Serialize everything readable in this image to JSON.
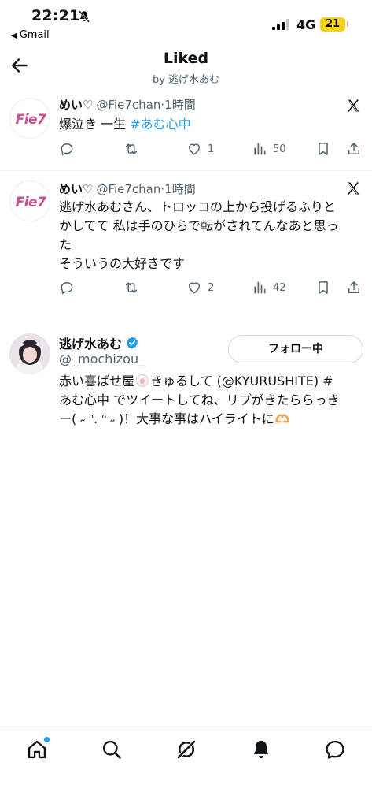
{
  "status_bar": {
    "time": "22:21",
    "back_app": "Gmail",
    "network": "4G",
    "battery": "21"
  },
  "header": {
    "title": "Liked",
    "subtitle": "by 逃げ水あむ"
  },
  "tweets": [
    {
      "name": "めい♡",
      "handle": "@Fie7chan",
      "time": "·1時間",
      "text": "爆泣き 一生 ",
      "hashtag": "#あむ心中",
      "likes": "1",
      "views": "50",
      "avatar_text": "Fie7"
    },
    {
      "name": "めい♡",
      "handle": "@Fie7chan",
      "time": "·1時間",
      "text_lines": [
        "逃げ水あむさん、トロッコの上から投げるふりと",
        "かしてて 私は手のひらで転がされてんなあと思っ",
        "た",
        "そういうの大好きです"
      ],
      "likes": "2",
      "views": "42",
      "avatar_text": "Fie7"
    }
  ],
  "profile_card": {
    "name": "逃げ水あむ",
    "handle": "@_mochizou_",
    "follow_label": "フォロー中",
    "bio_line1_a": "赤い喜ばせ屋",
    "bio_line1_b": "きゅるして (@KYURUSHITE) #",
    "bio_line2": "あむ心中 でツイートしてね、リプがきたららっき",
    "bio_line3": "ー( ˶ ᐢ. ᐢ ˶ )！大事な事はハイライトに"
  },
  "icons": {
    "back": "back-arrow-icon",
    "x_logo": "x-logo-icon",
    "reply": "reply-icon",
    "retweet": "retweet-icon",
    "like": "heart-icon",
    "views": "views-icon",
    "bookmark": "bookmark-icon",
    "share": "share-icon",
    "nav": [
      "home-icon",
      "search-icon",
      "grok-icon",
      "notifications-icon",
      "messages-icon"
    ]
  },
  "colors": {
    "accent": "#1d9bf0",
    "secondary_text": "#536471",
    "battery": "#f7d21a"
  }
}
